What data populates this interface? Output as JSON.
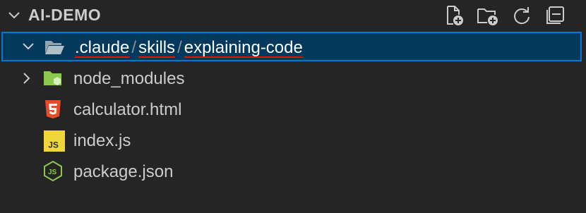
{
  "explorer": {
    "title": "AI-DEMO",
    "actions": [
      {
        "name": "new-file",
        "icon": "new-file-icon"
      },
      {
        "name": "new-folder",
        "icon": "new-folder-icon"
      },
      {
        "name": "refresh",
        "icon": "refresh-icon"
      },
      {
        "name": "collapse-all",
        "icon": "collapse-all-icon"
      }
    ]
  },
  "tree": {
    "selected_folder": {
      "segments": [
        ".claude",
        "skills",
        "explaining-code"
      ],
      "separator": "/",
      "icon": "folder-open-icon",
      "expanded": true
    },
    "items": [
      {
        "label": "node_modules",
        "icon": "node-folder-icon",
        "type": "folder",
        "expanded": false
      },
      {
        "label": "calculator.html",
        "icon": "html5-icon",
        "type": "file"
      },
      {
        "label": "index.js",
        "icon": "javascript-icon",
        "type": "file",
        "icon_text": "JS"
      },
      {
        "label": "package.json",
        "icon": "node-json-icon",
        "type": "file",
        "icon_text": "JS"
      }
    ]
  },
  "colors": {
    "background": "#252526",
    "selection_bg": "#04395e",
    "selection_border": "#0078d4",
    "underline": "#e51400",
    "html_orange": "#e44d26",
    "js_yellow": "#f0d63a",
    "node_green": "#8cc84b"
  }
}
